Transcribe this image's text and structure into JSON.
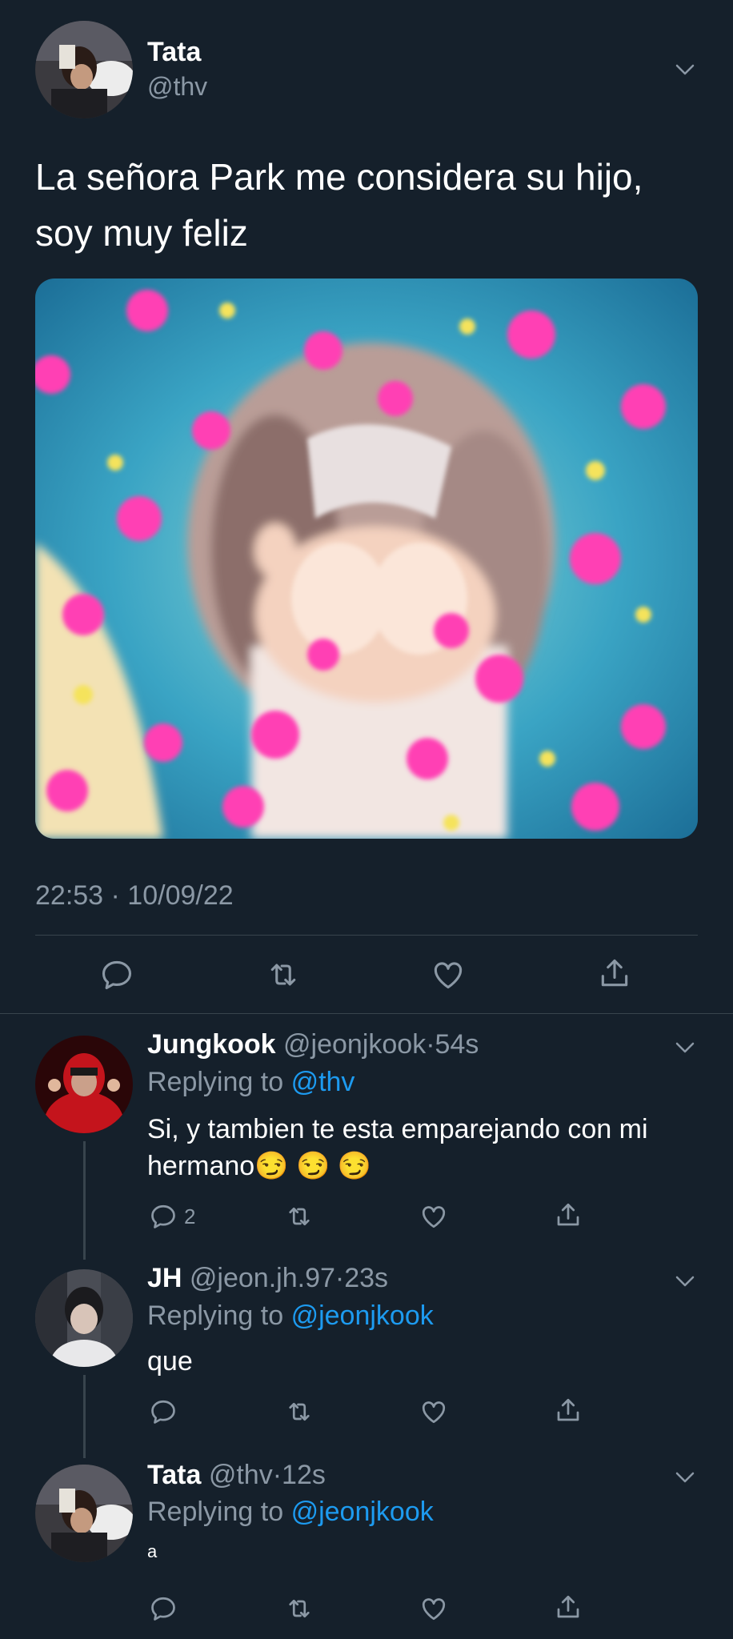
{
  "main_tweet": {
    "name": "Tata",
    "handle": "@thv",
    "text_line1": "La señora Park me considera su hijo,",
    "text_line2": "soy muy feliz",
    "timestamp": "22:53 · 10/09/22"
  },
  "replies": [
    {
      "name": "Jungkook",
      "handle": "@jeonjkook",
      "sep": "·",
      "time": "54s",
      "replying_prefix": "Replying to",
      "replying_to": "@thv",
      "text_line1": "Si, y tambien te esta emparejando con mi",
      "text_line2": "hermano",
      "emojis": "😏 😏 😏",
      "reply_count": "2"
    },
    {
      "name": "JH",
      "handle": "@jeon.jh.97",
      "sep": "·",
      "time": "23s",
      "replying_prefix": "Replying to",
      "replying_to": "@jeonjkook",
      "text": "que"
    },
    {
      "name": "Tata",
      "handle": "@thv",
      "sep": "·",
      "time": "12s",
      "replying_prefix": "Replying to",
      "replying_to": "@jeonjkook",
      "text": "a"
    }
  ],
  "icons": {
    "reply": "reply-icon",
    "retweet": "retweet-icon",
    "like": "heart-icon",
    "share": "share-icon",
    "more": "chevron-down-icon"
  },
  "colors": {
    "background": "#15202b",
    "divider": "#38444d",
    "muted": "#8b98a5",
    "link": "#1d9bf0"
  }
}
